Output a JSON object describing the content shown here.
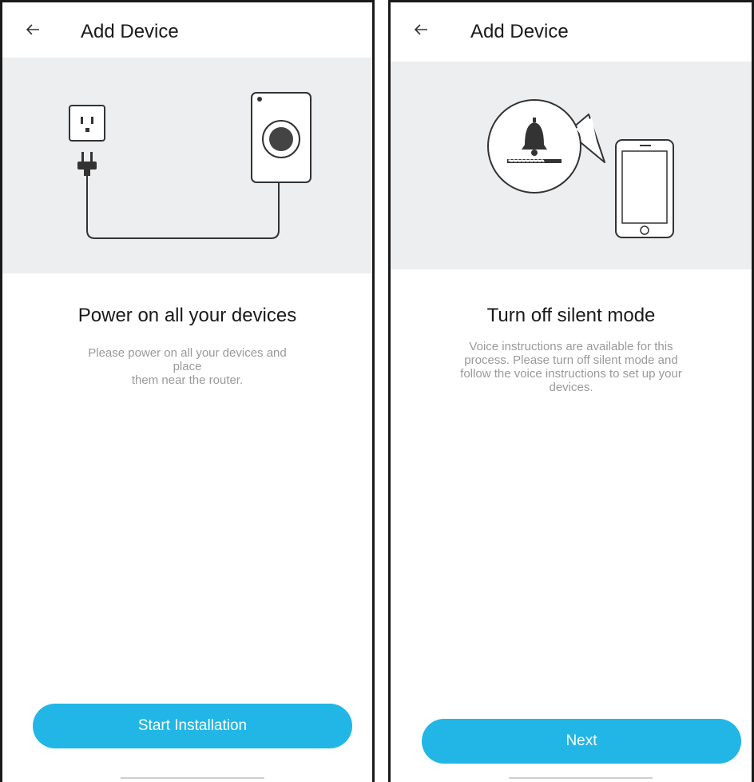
{
  "left_screen": {
    "header": {
      "title": "Add Device",
      "back_icon": "arrow-left-icon"
    },
    "illustration": {
      "icons": [
        "wall-outlet-icon",
        "power-plug-icon",
        "device-icon",
        "cable"
      ]
    },
    "heading": "Power on all your devices",
    "description_lines": [
      "Please power on all your devices and",
      "place",
      "them near the router."
    ],
    "button_label": "Start Installation"
  },
  "right_screen": {
    "header": {
      "title": "Add Device",
      "back_icon": "arrow-left-icon"
    },
    "illustration": {
      "icons": [
        "bell-icon",
        "volume-bar",
        "smartphone-icon"
      ]
    },
    "heading": "Turn off silent mode",
    "description_lines": [
      "Voice instructions are available for this",
      "process. Please turn off silent mode and",
      "follow the voice instructions to set up your",
      "devices."
    ],
    "button_label": "Next"
  },
  "colors": {
    "accent": "#21b6e5",
    "hero_bg": "#eceeef",
    "text": "#1a1a1a",
    "muted_text": "#9a9a9a"
  }
}
